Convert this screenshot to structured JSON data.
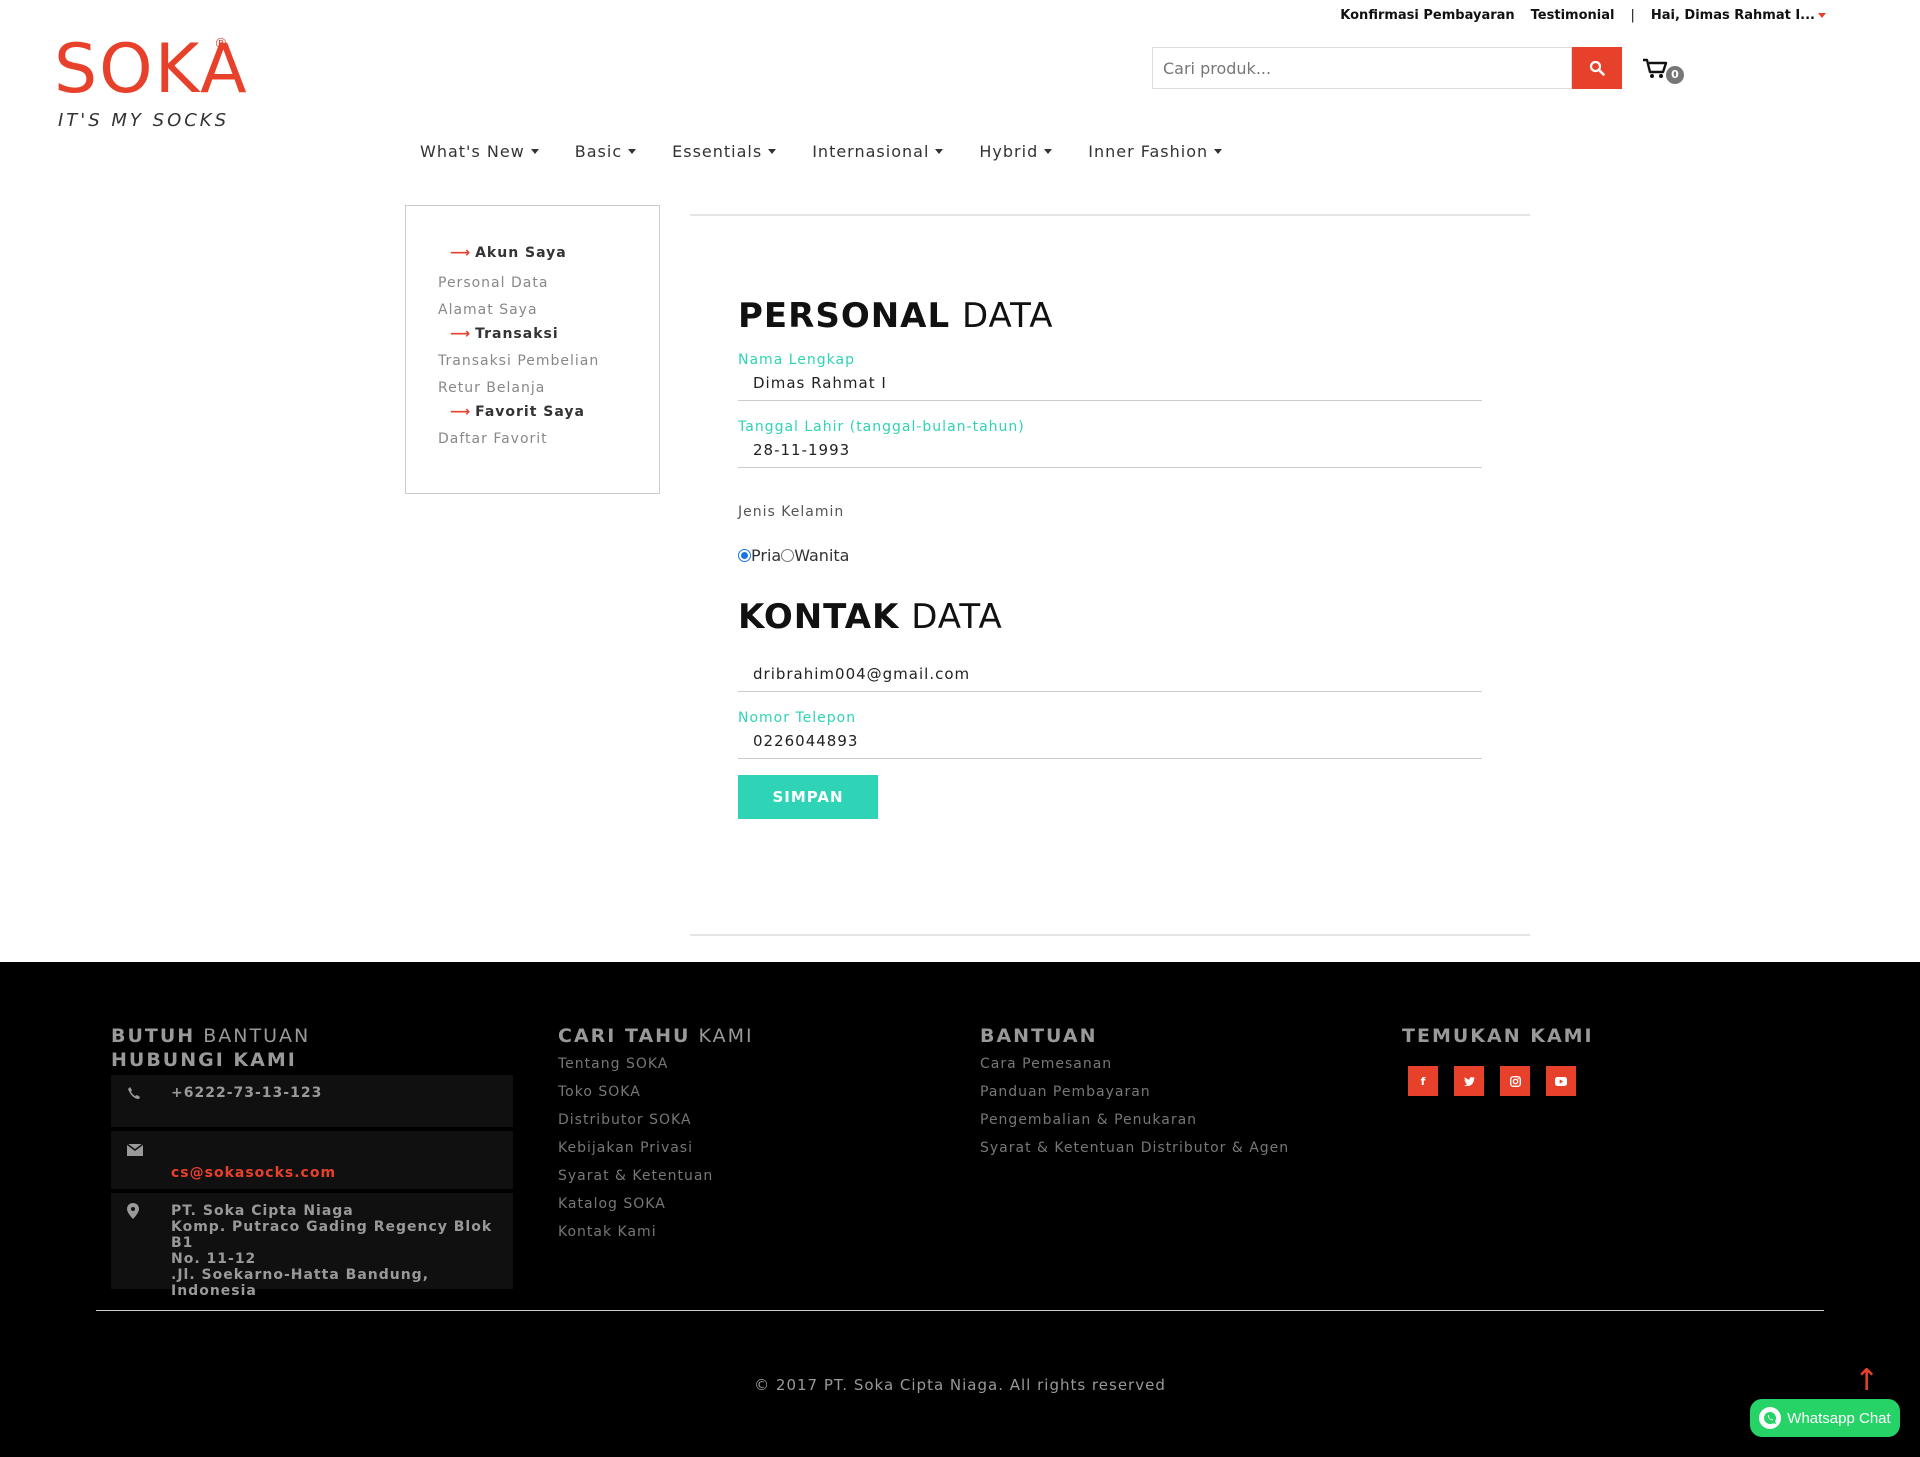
{
  "topbar": {
    "konfirmasi": "Konfirmasi Pembayaran",
    "testimonial": "Testimonial",
    "separator": "|",
    "user_greeting": "Hai, Dimas Rahmat I..."
  },
  "logo": {
    "mark": "SOKA",
    "registered": "®",
    "tagline": "IT'S MY SOCKS",
    "color": "#e8412b"
  },
  "search": {
    "placeholder": "Cari produk...",
    "icon": "search-icon"
  },
  "cart": {
    "icon": "cart-icon",
    "count": "0"
  },
  "nav": {
    "items": [
      "What's New",
      "Basic",
      "Essentials",
      "Internasional",
      "Hybrid",
      "Inner Fashion"
    ]
  },
  "sidebar": {
    "akun_saya": "Akun Saya",
    "personal_data": "Personal Data",
    "alamat_saya": "Alamat Saya",
    "transaksi": "Transaksi",
    "transaksi_pembelian": "Transaksi Pembelian",
    "retur_belanja": "Retur Belanja",
    "favorit_saya": "Favorit Saya",
    "daftar_favorit": "Daftar Favorit",
    "arrow": "⟶"
  },
  "personal": {
    "title_bold": "PERSONAL",
    "title_light": "DATA",
    "nama_label": "Nama Lengkap",
    "nama_value": "Dimas Rahmat I",
    "tanggal_label": "Tanggal Lahir (tanggal-bulan-tahun)",
    "tanggal_value": "28-11-1993",
    "gender_label": "Jenis Kelamin",
    "gender_pria": "Pria",
    "gender_wanita": "Wanita",
    "gender_selected": "Pria"
  },
  "kontak": {
    "title_bold": "KONTAK",
    "title_light": "DATA",
    "email_value": "dribrahim004@gmail.com",
    "telepon_label": "Nomor Telepon",
    "telepon_value": "0226044893",
    "save_label": "SIMPAN"
  },
  "footer": {
    "col1_title_bold": "BUTUH",
    "col1_title_light": "BANTUAN",
    "col1_title_2": "HUBUNGI KAMI",
    "phone": "+6222-73-13-123",
    "email": "cs@sokasocks.com",
    "address_1": "PT. Soka Cipta Niaga",
    "address_2": "Komp. Putraco Gading Regency Blok B1",
    "address_3": "No. 11-12",
    "address_4": ".Jl. Soekarno-Hatta Bandung, Indonesia",
    "col2_title_bold": "CARI TAHU",
    "col2_title_light": "KAMI",
    "col2_links": [
      "Tentang SOKA",
      "Toko SOKA",
      "Distributor SOKA",
      "Kebijakan Privasi",
      "Syarat & Ketentuan",
      "Katalog SOKA",
      "Kontak Kami"
    ],
    "col3_title": "BANTUAN",
    "col3_links": [
      "Cara Pemesanan",
      "Panduan Pembayaran",
      "Pengembalian & Penukaran",
      "Syarat & Ketentuan Distributor & Agen"
    ],
    "col4_title": "TEMUKAN KAMI",
    "social": [
      "facebook-icon",
      "twitter-icon",
      "instagram-icon",
      "youtube-icon"
    ],
    "copyright": "© 2017 PT. Soka Cipta Niaga. All rights reserved"
  },
  "whatsapp": {
    "label": "Whatsapp Chat"
  },
  "scroll_top": "↑"
}
